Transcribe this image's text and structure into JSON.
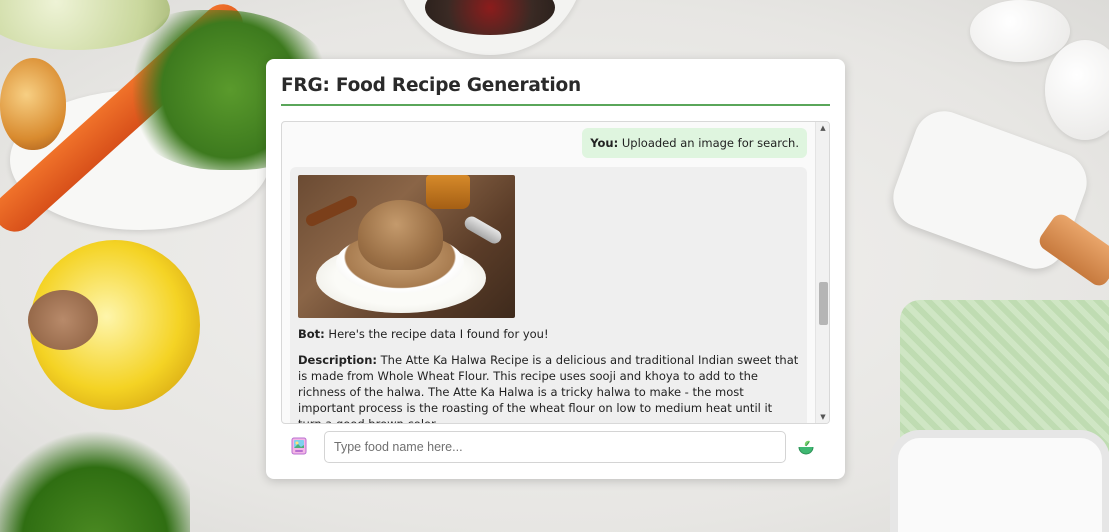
{
  "app": {
    "title": "FRG: Food Recipe Generation"
  },
  "chat": {
    "user_message": {
      "sender": "You:",
      "text": "Uploaded an image for search."
    },
    "bot_message": {
      "image_alt": "Atte Ka Halwa in a bowl",
      "sender": "Bot:",
      "text": "Here's the recipe data I found for you!",
      "description_label": "Description:",
      "description_text": "The Atte Ka Halwa Recipe is a delicious and traditional Indian sweet that is made from Whole Wheat Flour. This recipe uses sooji and khoya to add to the richness of the halwa. The Atte Ka Halwa is a tricky halwa to make - the most important process is the roasting of the wheat flour on low to medium heat until it turn a good brown color."
    }
  },
  "input": {
    "placeholder": "Type food name here...",
    "value": ""
  },
  "icons": {
    "upload": "image-upload-icon",
    "send": "send-icon",
    "scroll_up": "▲",
    "scroll_down": "▼"
  },
  "colors": {
    "accent_green": "#5aa65a",
    "user_bubble": "#dff5df",
    "bot_bubble": "#efefef"
  }
}
